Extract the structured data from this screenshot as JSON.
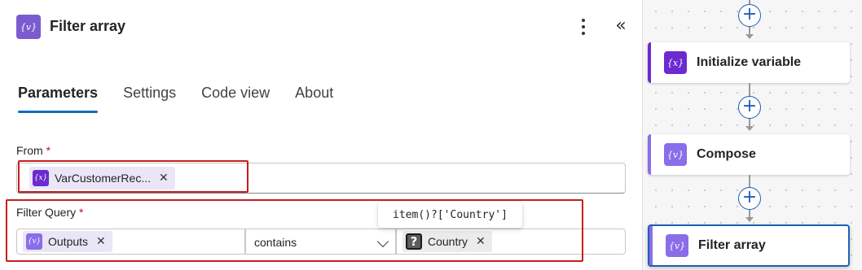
{
  "panel": {
    "title": "Filter array",
    "icon": "{v}",
    "tabs": [
      {
        "label": "Parameters",
        "active": true
      },
      {
        "label": "Settings",
        "active": false
      },
      {
        "label": "Code view",
        "active": false
      },
      {
        "label": "About",
        "active": false
      }
    ],
    "from": {
      "label": "From",
      "required_mark": "*",
      "token": {
        "icon": "{x}",
        "text": "VarCustomerRec...",
        "remove": "✕"
      }
    },
    "filter_query": {
      "label": "Filter Query",
      "required_mark": "*",
      "left_token": {
        "icon": "{v}",
        "text": "Outputs",
        "remove": "✕"
      },
      "operator": "contains",
      "right_token": {
        "icon": "?",
        "text": "Country",
        "remove": "✕"
      },
      "tooltip": "item()?['Country']"
    },
    "highlight_color": "#c81e1e"
  },
  "flow": {
    "steps": [
      {
        "title": "Initialize variable",
        "icon": "{x}",
        "color": "#6b2bcf"
      },
      {
        "title": "Compose",
        "icon": "{v}",
        "color": "#8a6de9"
      },
      {
        "title": "Filter array",
        "icon": "{v}",
        "color": "#8a6de9",
        "selected": true
      }
    ],
    "add_icon": "+"
  }
}
